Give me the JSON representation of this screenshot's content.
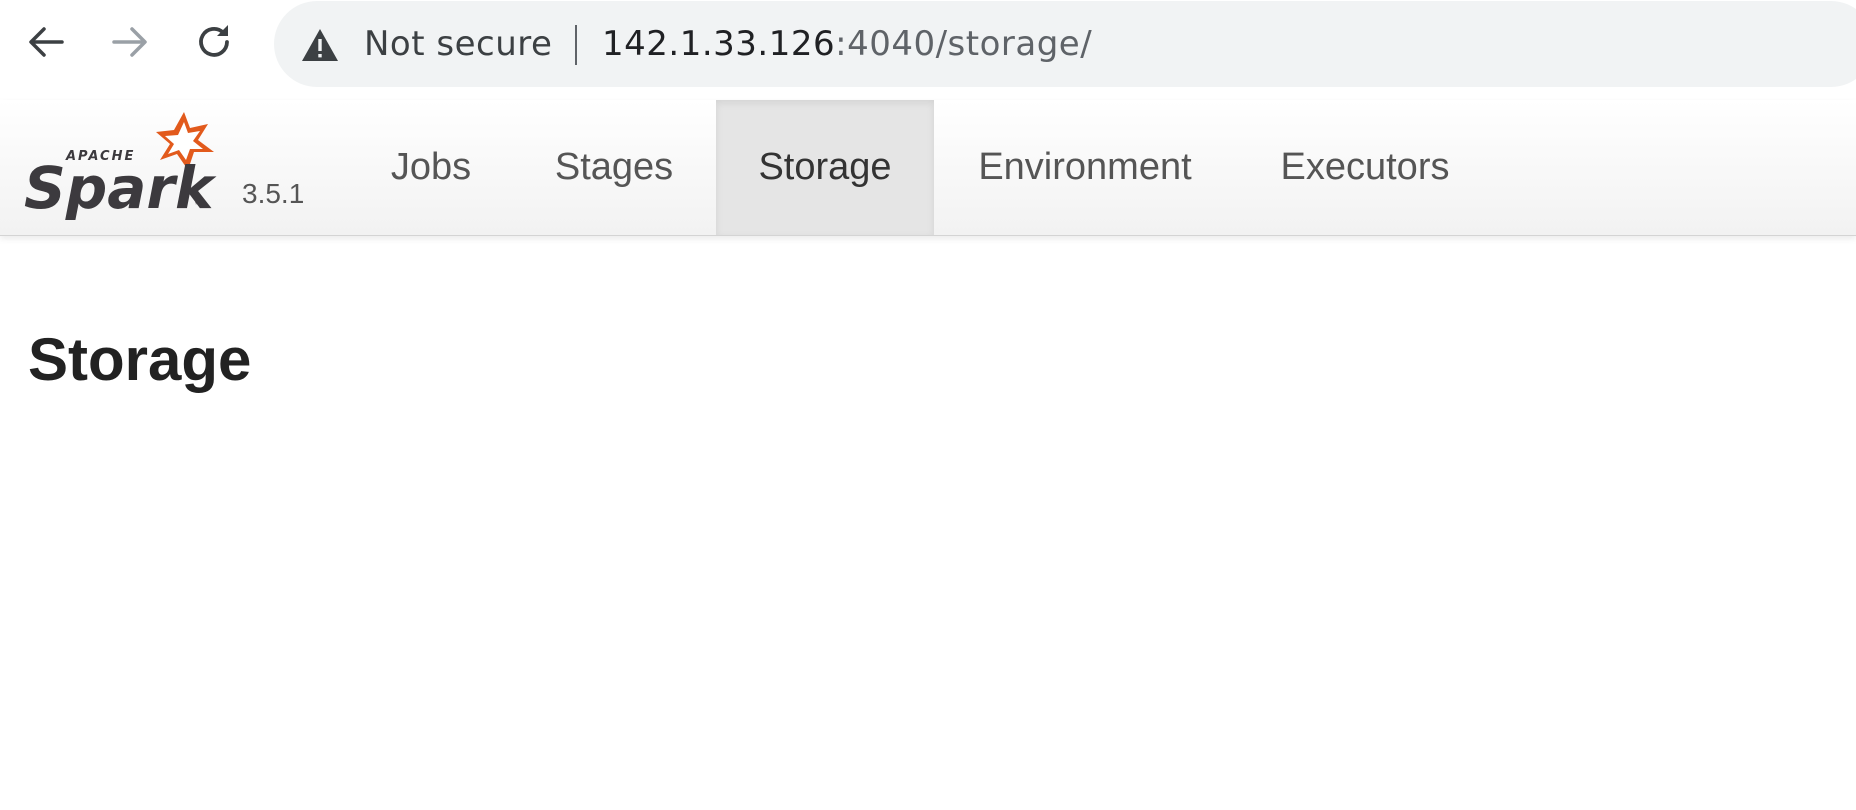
{
  "browser": {
    "security_label": "Not secure",
    "url_host": "142.1.33.126",
    "url_path": ":4040/storage/",
    "icons": [
      "back-arrow-icon",
      "forward-arrow-icon",
      "reload-icon",
      "warning-icon"
    ]
  },
  "spark_ui": {
    "logo_text": "Spark",
    "logo_prefix": "APACHE",
    "version": "3.5.1",
    "tabs": [
      {
        "label": "Jobs",
        "active": false
      },
      {
        "label": "Stages",
        "active": false
      },
      {
        "label": "Storage",
        "active": true
      },
      {
        "label": "Environment",
        "active": false
      },
      {
        "label": "Executors",
        "active": false
      }
    ],
    "colors": {
      "logo_orange": "#e25a1c",
      "logo_dark": "#3c3a3e",
      "active_tab_bg": "#e5e5e5"
    }
  },
  "page": {
    "title": "Storage"
  }
}
